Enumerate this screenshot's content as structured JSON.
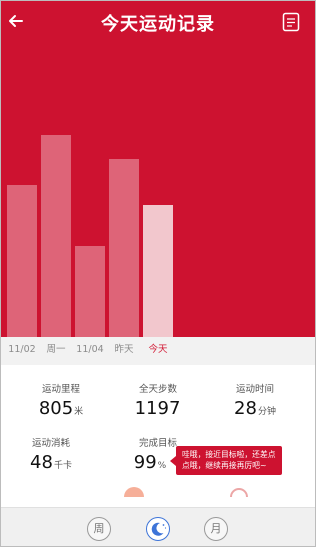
{
  "header": {
    "title": "今天运动记录"
  },
  "chart_data": {
    "type": "bar",
    "categories": [
      "",
      "",
      "11/02",
      "周一",
      "11/04",
      "昨天",
      "今天"
    ],
    "values": [
      152,
      202,
      91,
      178,
      132
    ],
    "bar_categories": [
      "",
      "11/02",
      "周一",
      "11/04",
      "今天"
    ],
    "selected": "今天",
    "ylim": [
      0,
      337
    ]
  },
  "days": [
    "11/02",
    "周一",
    "11/04",
    "昨天",
    "今天"
  ],
  "active_day": "今天",
  "stats": [
    {
      "label": "运动里程",
      "value": "805",
      "unit": "米"
    },
    {
      "label": "全天步数",
      "value": "1197",
      "unit": ""
    },
    {
      "label": "运动时间",
      "value": "28",
      "unit": "分钟"
    },
    {
      "label": "运动消耗",
      "value": "48",
      "unit": "千卡"
    },
    {
      "label": "完成目标",
      "value": "99",
      "unit": "%"
    }
  ],
  "tooltip": {
    "line1": "哇哦，接近目标啦，还差点",
    "line2": "点哦，继续再接再厉吧~"
  },
  "footer": {
    "week": "周",
    "month": "月"
  },
  "colors": {
    "brand": "#cd1230",
    "accent_blue": "#3d74d8"
  }
}
